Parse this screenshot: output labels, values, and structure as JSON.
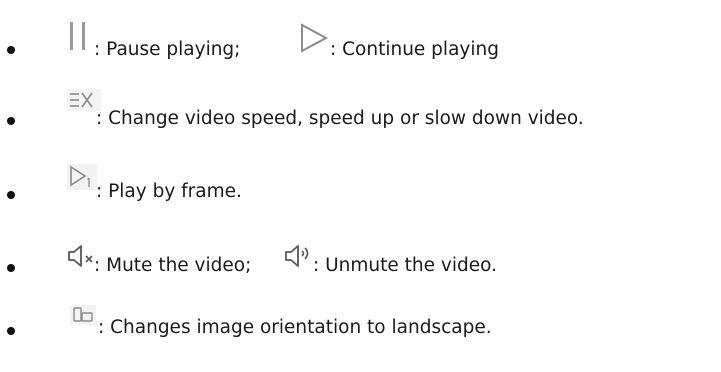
{
  "items": [
    {
      "segments": [
        {
          "icon": "pause-icon",
          "text": ": Pause playing; "
        },
        {
          "icon": "play-icon",
          "text": ": Continue playing"
        }
      ]
    },
    {
      "segments": [
        {
          "icon": "speed-icon",
          "icon_text": "≡X",
          "text": ": Change video speed, speed up or slow down video."
        }
      ]
    },
    {
      "segments": [
        {
          "icon": "frame-step-icon",
          "text": ": Play by frame."
        }
      ]
    },
    {
      "segments": [
        {
          "icon": "mute-icon",
          "text": ": Mute the video; "
        },
        {
          "icon": "unmute-icon",
          "text": ": Unmute the video."
        }
      ]
    },
    {
      "segments": [
        {
          "icon": "landscape-orientation-icon",
          "text": ": Changes image orientation to landscape."
        }
      ]
    }
  ],
  "colors": {
    "text": "#1a1a1a",
    "icon_stroke": "#8a8a8a",
    "icon_bg": "#f3f3f3"
  }
}
